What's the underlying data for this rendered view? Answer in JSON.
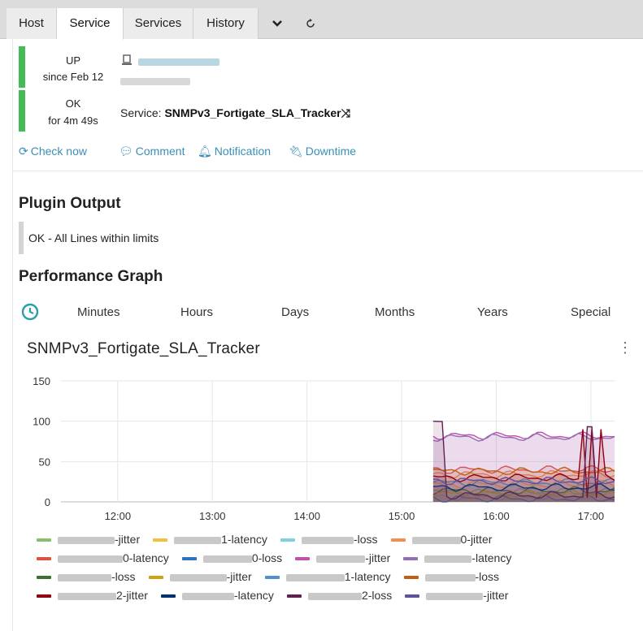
{
  "tabs": [
    {
      "label": "Host",
      "active": false
    },
    {
      "label": "Service",
      "active": true
    },
    {
      "label": "Services",
      "active": false
    },
    {
      "label": "History",
      "active": false
    }
  ],
  "tab_icons": [
    "chevron-down-icon",
    "refresh-icon"
  ],
  "host_state": {
    "state": "UP",
    "since": "since Feb 12"
  },
  "service_state": {
    "state": "OK",
    "duration": "for 4m 49s"
  },
  "service": {
    "prefix": "Service:",
    "name": "SNMPv3_Fortigate_SLA_Tracker",
    "icon": "shuffle-icon"
  },
  "actions": {
    "check_now": "Check now",
    "comment": "Comment",
    "notification": "Notification",
    "downtime": "Downtime"
  },
  "plugin_output": {
    "heading": "Plugin Output",
    "text": "OK - All Lines within limits"
  },
  "performance": {
    "heading": "Performance Graph",
    "ranges": [
      "Minutes",
      "Hours",
      "Days",
      "Months",
      "Years",
      "Special"
    ]
  },
  "chart_data": {
    "type": "area",
    "title": "SNMPv3_Fortigate_SLA_Tracker",
    "x_ticks": [
      "12:00",
      "13:00",
      "14:00",
      "15:00",
      "16:00",
      "17:00"
    ],
    "y_ticks": [
      0,
      50,
      100,
      150
    ],
    "ylim": [
      0,
      150
    ],
    "xlim_hours": [
      11.4,
      17.25
    ],
    "grid": true,
    "legend_placement": "bottom",
    "data_start": "15:20",
    "legend": [
      {
        "suffix": "-jitter",
        "color": "#88c070"
      },
      {
        "suffix": "1-latency",
        "color": "#f0c040"
      },
      {
        "suffix": "-loss",
        "color": "#80d0e0"
      },
      {
        "suffix": "0-jitter",
        "color": "#f09050"
      },
      {
        "suffix": "0-latency",
        "color": "#e05040"
      },
      {
        "suffix": "0-loss",
        "color": "#3070c0"
      },
      {
        "suffix": "-jitter",
        "color": "#c050b0"
      },
      {
        "suffix": "-latency",
        "color": "#9070b0"
      },
      {
        "suffix": "-loss",
        "color": "#407030"
      },
      {
        "suffix": "-jitter",
        "color": "#d0a010"
      },
      {
        "suffix": "1-latency",
        "color": "#5090d0"
      },
      {
        "suffix": "-loss",
        "color": "#c06010"
      },
      {
        "suffix": "2-jitter",
        "color": "#900010"
      },
      {
        "suffix": "-latency",
        "color": "#003070"
      },
      {
        "suffix": "2-loss",
        "color": "#602050"
      },
      {
        "suffix": "-jitter",
        "color": "#6050a0"
      }
    ]
  }
}
